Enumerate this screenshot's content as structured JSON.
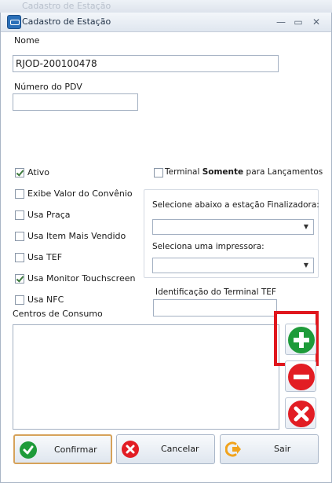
{
  "window": {
    "ghost_title": "Cadastro de Estação",
    "title": "Cadastro de Estação",
    "minimize_glyph": "—",
    "maximize_glyph": "▭",
    "close_glyph": "✕"
  },
  "form": {
    "nome_label": "Nome",
    "nome_value": "RJOD-200100478",
    "pdv_label": "Número do PDV",
    "pdv_value": ""
  },
  "checkboxes": [
    {
      "label": "Ativo",
      "checked": true
    },
    {
      "label": "Exibe Valor do Convênio",
      "checked": false
    },
    {
      "label": "Usa Praça",
      "checked": false
    },
    {
      "label": "Usa Item Mais Vendido",
      "checked": false
    },
    {
      "label": "Usa TEF",
      "checked": false
    },
    {
      "label": "Usa Monitor Touchscreen",
      "checked": true
    },
    {
      "label": "Usa NFC",
      "checked": false
    }
  ],
  "terminal": {
    "prefix": "Terminal ",
    "bold": "Somente",
    "suffix": " para Lançamentos",
    "checked": false
  },
  "finalizadora": {
    "label": "Selecione abaixo a estação Finalizadora:",
    "value": ""
  },
  "impressora": {
    "label": "Seleciona uma impressora:",
    "value": ""
  },
  "tef": {
    "label": "Identificação do Terminal TEF",
    "value": ""
  },
  "consumo": {
    "label": "Centros de Consumo"
  },
  "icons": {
    "add": "plus-circle-icon",
    "remove": "minus-circle-icon",
    "delete": "x-circle-icon",
    "confirm": "check-circle-icon",
    "cancel": "x-circle-icon",
    "exit": "exit-arrow-icon"
  },
  "colors": {
    "add_green": "#1e9b3a",
    "remove_red": "#e21d24",
    "highlight_red": "#e0161d",
    "exit_orange": "#f1a31d"
  },
  "buttons": {
    "confirm": "Confirmar",
    "cancel": "Cancelar",
    "exit": "Sair"
  }
}
